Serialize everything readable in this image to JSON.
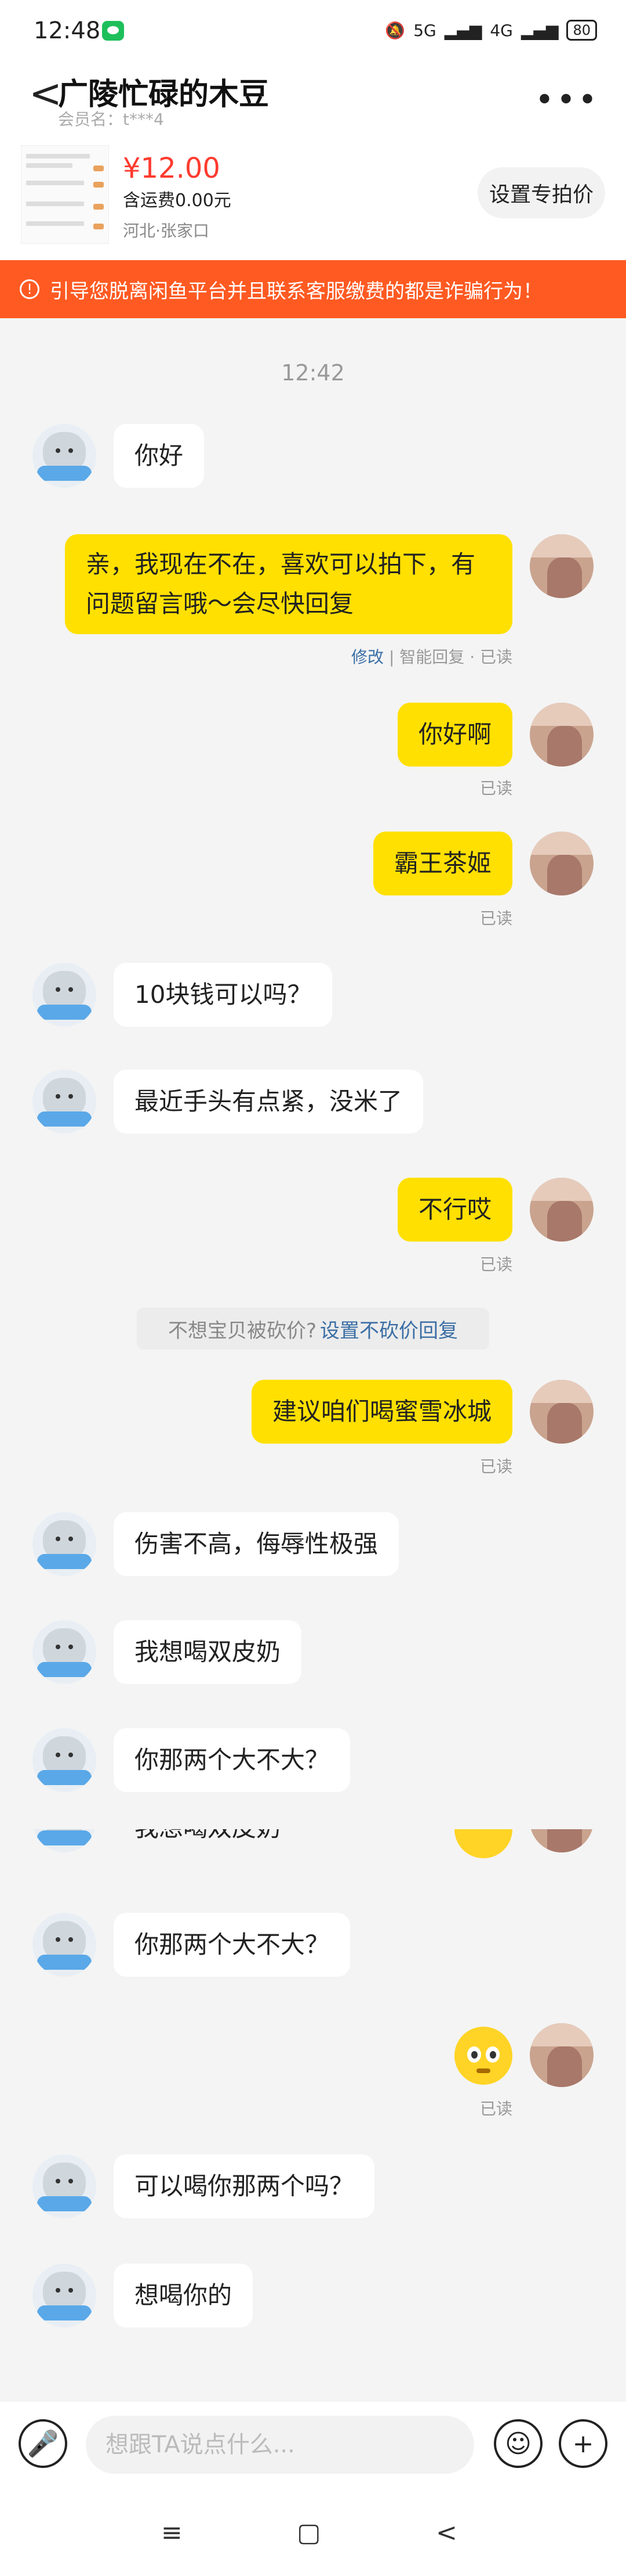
{
  "status_bar": {
    "time": "12:48",
    "network": "5G",
    "network2": "4G",
    "battery": "80"
  },
  "header": {
    "back": "<",
    "title": "广陵忙碌的木豆",
    "subtitle": "会员名：t***4",
    "more": "•••"
  },
  "product": {
    "price": "¥12.00",
    "shipping": "含运费0.00元",
    "location": "河北·张家口",
    "set_price_button": "设置专拍价"
  },
  "warning": {
    "icon": "!",
    "text": "引导您脱离闲鱼平台并且联系客服缴费的都是诈骗行为！"
  },
  "chat": {
    "timestamp": "12:42",
    "messages": [
      {
        "side": "left",
        "text": "你好"
      },
      {
        "side": "right",
        "text": "亲，我现在不在，喜欢可以拍下，有问题留言哦～会尽快回复",
        "status_edit": "修改",
        "status_rest": "| 智能回复 · 已读"
      },
      {
        "side": "right",
        "text": "你好啊",
        "status": "已读"
      },
      {
        "side": "right",
        "text": "霸王茶姬",
        "status": "已读"
      },
      {
        "side": "left",
        "text": "10块钱可以吗？"
      },
      {
        "side": "left",
        "text": "最近手头有点紧，没米了"
      },
      {
        "side": "right",
        "text": "不行哎",
        "status": "已读"
      },
      {
        "side": "right",
        "text": "建议咱们喝蜜雪冰城",
        "status": "已读"
      },
      {
        "side": "left",
        "text": "伤害不高，侮辱性极强"
      },
      {
        "side": "left",
        "text": "我想喝双皮奶"
      },
      {
        "side": "left",
        "text": "你那两个大不大？"
      },
      {
        "side": "left",
        "text": "你那两个大不大？"
      },
      {
        "side": "right",
        "type": "emoji",
        "status": "已读"
      },
      {
        "side": "left",
        "text": "可以喝你那两个吗？"
      },
      {
        "side": "left",
        "text": "想喝你的"
      }
    ],
    "glitch_text": "我想喝双皮奶",
    "hint": {
      "text": "不想宝贝被砍价?",
      "link": "设置不砍价回复"
    }
  },
  "input_bar": {
    "placeholder": "想跟TA说点什么...",
    "voice_icon": "🎤",
    "emoji_icon": "☺",
    "plus_icon": "+"
  },
  "nav_bar": {
    "menu": "≡",
    "home": "▢",
    "back": "<"
  }
}
